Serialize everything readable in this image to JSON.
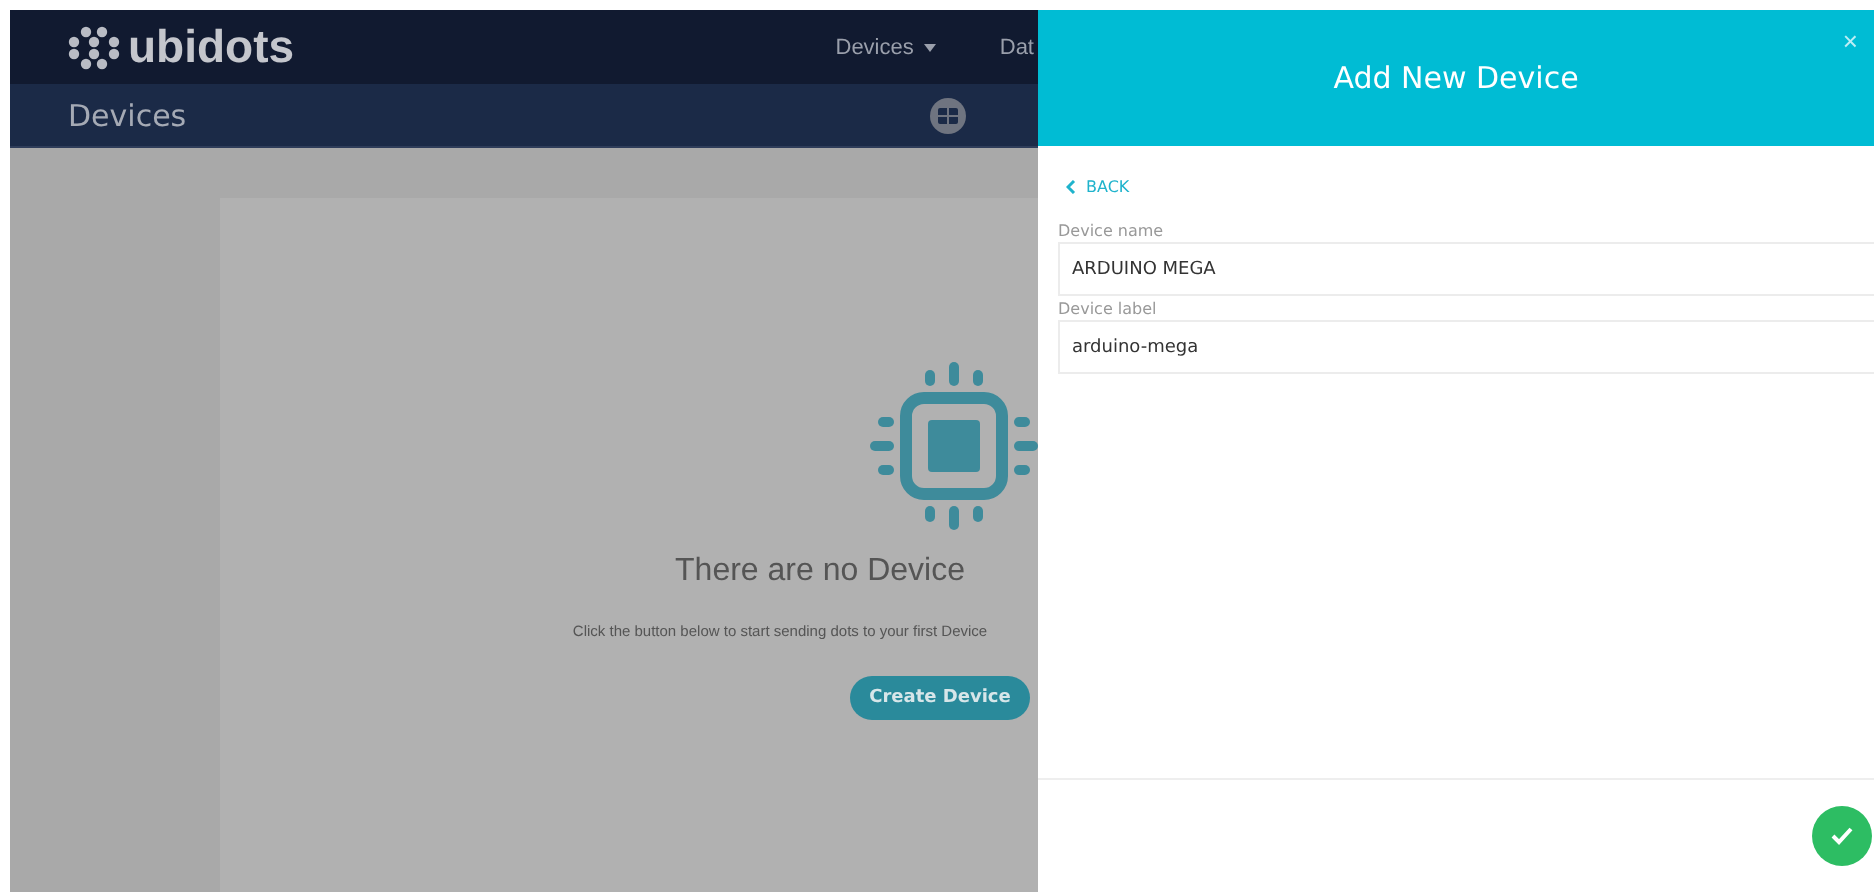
{
  "app": {
    "logo": "ubidots",
    "nav": [
      {
        "label": "Devices",
        "dropdown": true
      },
      {
        "label": "Dat",
        "dropdown": false
      }
    ],
    "page_title": "Devices"
  },
  "empty_state": {
    "title": "There are no Device",
    "message": "Click the button below to start sending dots to your first Device",
    "button": "Create Device"
  },
  "panel": {
    "title": "Add New Device",
    "close": "×",
    "back": "BACK",
    "fields": [
      {
        "label": "Device name",
        "value": "ARDUINO MEGA"
      },
      {
        "label": "Device label",
        "value": "arduino-mega"
      }
    ]
  }
}
